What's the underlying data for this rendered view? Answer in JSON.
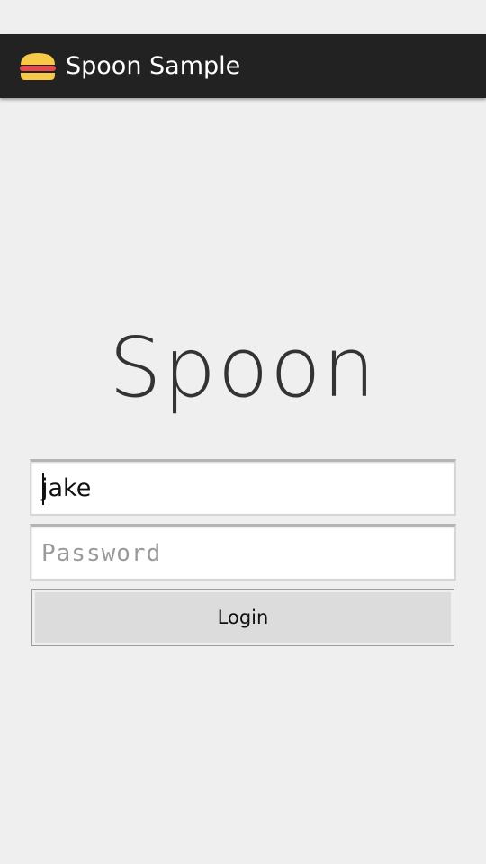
{
  "status_bar": {},
  "action_bar": {
    "app_icon": "burger-icon",
    "title": "Spoon Sample",
    "background_color": "#222222"
  },
  "main": {
    "logo_text": "Spoon",
    "username": {
      "value": "jake",
      "placeholder": ""
    },
    "password": {
      "value": "",
      "placeholder": "Password"
    },
    "login_button_label": "Login"
  }
}
